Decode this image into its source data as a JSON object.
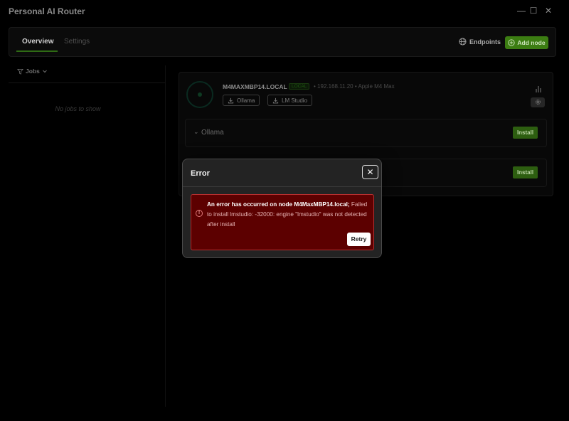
{
  "window": {
    "title": "Personal AI Router",
    "controls": {
      "minimize": "—",
      "maximize": "☐",
      "close": "✕"
    }
  },
  "navbar": {
    "tabs": [
      {
        "label": "Overview",
        "active": true
      },
      {
        "label": "Settings",
        "active": false
      }
    ],
    "endpoints_label": "Endpoints",
    "add_node_label": "Add node",
    "accent": "#3c7d12"
  },
  "jobs": {
    "filter_label": "Jobs",
    "empty_text": "No jobs to show"
  },
  "node": {
    "name": "M4MAXMBP14.LOCAL",
    "badge": "LOCAL",
    "ip": "192.168.11.20",
    "device": "Apple M4 Max",
    "separator": "•",
    "install_pills": [
      "Ollama",
      "LM Studio"
    ],
    "providers": [
      {
        "name": "Ollama",
        "install_label": "Install"
      },
      {
        "name": "",
        "install_label": "Install"
      }
    ]
  },
  "modal": {
    "title": "Error",
    "close_label": "✕",
    "error_lead": "An error has occurred on node M4MaxMBP14.local;",
    "error_detail": " Failed to install lmstudio: -32000: engine \"lmstudio\" was not detected after install",
    "retry_label": "Retry",
    "error_bg": "#5c0000"
  }
}
